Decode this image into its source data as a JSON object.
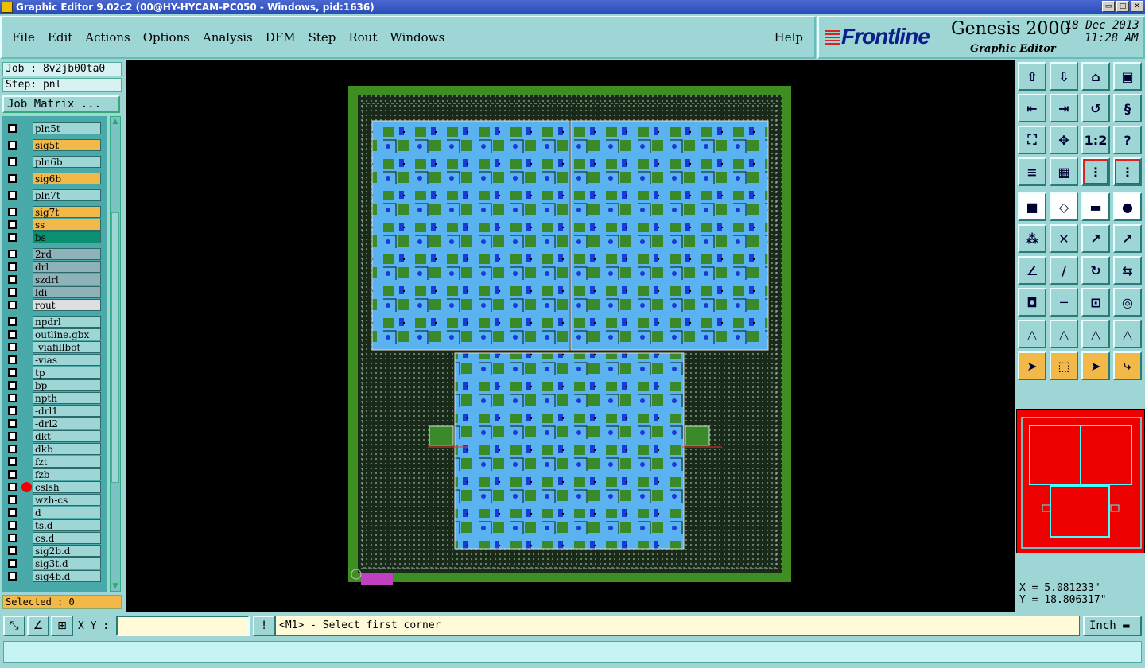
{
  "window": {
    "title": "Graphic Editor 9.02c2 (00@HY-HYCAM-PC050 - Windows, pid:1636)",
    "controls": [
      "restore",
      "maximize",
      "close"
    ]
  },
  "menu": {
    "items": [
      "File",
      "Edit",
      "Actions",
      "Options",
      "Analysis",
      "DFM",
      "Step",
      "Rout",
      "Windows"
    ],
    "help": "Help"
  },
  "brand": {
    "logo": "Frontline",
    "product": "Genesis 2000",
    "subtitle": "Graphic Editor",
    "date": "18 Dec 2013",
    "time": "11:28 AM"
  },
  "job": {
    "job_label": "Job : 8v2jb00ta0",
    "step_label": "Step: pnl",
    "matrix_button": "Job Matrix ..."
  },
  "layers": [
    {
      "name": "pln5t",
      "color": "#9ed6d6"
    },
    {
      "name": "sig5t",
      "color": "#f3b948"
    },
    {
      "name": "pln6b",
      "color": "#9ed6d6"
    },
    {
      "name": "sig6b",
      "color": "#f3b948"
    },
    {
      "name": "pln7t",
      "color": "#9ed6d6"
    },
    {
      "name": "sig7t",
      "color": "#f3b948"
    },
    {
      "name": "ss",
      "color": "#f3b948"
    },
    {
      "name": "bs",
      "color": "#0a9070"
    },
    {
      "name": "2rd",
      "color": "#8fb2b8"
    },
    {
      "name": "drl",
      "color": "#8fb2b8"
    },
    {
      "name": "szdrl",
      "color": "#8fb2b8"
    },
    {
      "name": "ldi",
      "color": "#8fb2b8"
    },
    {
      "name": "rout",
      "color": "#dedede"
    },
    {
      "name": "npdrl",
      "color": "#9ed6d6"
    },
    {
      "name": "outline.gbx",
      "color": "#9ed6d6"
    },
    {
      "name": "-viafillbot",
      "color": "#9ed6d6"
    },
    {
      "name": "-vias",
      "color": "#9ed6d6"
    },
    {
      "name": "tp",
      "color": "#9ed6d6"
    },
    {
      "name": "bp",
      "color": "#9ed6d6"
    },
    {
      "name": "npth",
      "color": "#9ed6d6"
    },
    {
      "name": "-drl1",
      "color": "#9ed6d6"
    },
    {
      "name": "-drl2",
      "color": "#9ed6d6"
    },
    {
      "name": "dkt",
      "color": "#9ed6d6"
    },
    {
      "name": "dkb",
      "color": "#9ed6d6"
    },
    {
      "name": "fzt",
      "color": "#9ed6d6"
    },
    {
      "name": "fzb",
      "color": "#9ed6d6"
    },
    {
      "name": "cslsh",
      "color": "#9ed6d6",
      "marked": true
    },
    {
      "name": "wzh-cs",
      "color": "#9ed6d6"
    },
    {
      "name": "d",
      "color": "#9ed6d6"
    },
    {
      "name": "ts.d",
      "color": "#9ed6d6"
    },
    {
      "name": "cs.d",
      "color": "#9ed6d6"
    },
    {
      "name": "sig2b.d",
      "color": "#9ed6d6"
    },
    {
      "name": "sig3t.d",
      "color": "#9ed6d6"
    },
    {
      "name": "sig4b.d",
      "color": "#9ed6d6"
    }
  ],
  "selection": {
    "label": "Selected : 0"
  },
  "tools": [
    {
      "name": "export-icon"
    },
    {
      "name": "import-icon"
    },
    {
      "name": "home-icon"
    },
    {
      "name": "window-icon"
    },
    {
      "name": "left-icon"
    },
    {
      "name": "right-icon"
    },
    {
      "name": "swap-icon"
    },
    {
      "name": "s-curve-icon"
    },
    {
      "name": "fit-icon"
    },
    {
      "name": "zoom-icon"
    },
    {
      "name": "ratio-icon",
      "text": "1:2"
    },
    {
      "name": "help-icon",
      "text": "?"
    },
    {
      "name": "measure-tools-icon"
    },
    {
      "name": "grid-icon"
    },
    {
      "name": "snap-icon"
    },
    {
      "name": "snap-alt-icon"
    },
    {
      "name": "pad-icon"
    },
    {
      "name": "poly-icon"
    },
    {
      "name": "ruler-icon"
    },
    {
      "name": "dot-icon"
    },
    {
      "name": "net-icon"
    },
    {
      "name": "cross-icon"
    },
    {
      "name": "line-icon"
    },
    {
      "name": "line-alt-icon"
    },
    {
      "name": "angle-icon"
    },
    {
      "name": "diag-icon"
    },
    {
      "name": "arc-icon"
    },
    {
      "name": "flip-icon"
    },
    {
      "name": "feature-icon"
    },
    {
      "name": "minus-icon"
    },
    {
      "name": "box-icon"
    },
    {
      "name": "circle-icon"
    },
    {
      "name": "tri-icon"
    },
    {
      "name": "tri-alt-icon"
    },
    {
      "name": "tri-bold-icon"
    },
    {
      "name": "tri-cross-icon"
    },
    {
      "name": "pointer-icon"
    },
    {
      "name": "pointer-box-icon"
    },
    {
      "name": "pointer-alt-icon"
    },
    {
      "name": "route-icon"
    }
  ],
  "coordinates": {
    "x": "X = 5.081233\"",
    "y": "Y = 18.806317\""
  },
  "bottom": {
    "xy_label": "X Y :",
    "xy_value": "",
    "prompt": "<M1> - Select first corner",
    "units": "Inch"
  }
}
